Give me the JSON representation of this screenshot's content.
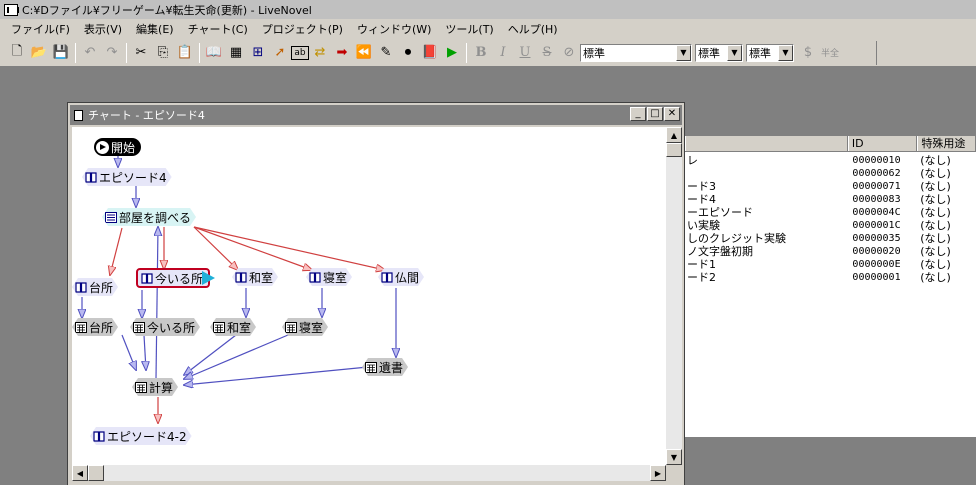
{
  "app": {
    "title": "C:¥Dファイル¥フリーゲーム¥転生天命(更新) - LiveNovel"
  },
  "menu": [
    "ファイル(F)",
    "表示(V)",
    "編集(E)",
    "チャート(C)",
    "プロジェクト(P)",
    "ウィンドウ(W)",
    "ツール(T)",
    "ヘルプ(H)"
  ],
  "toolbar": {
    "icons": [
      "new-icon",
      "open-icon",
      "save-icon",
      "undo-icon",
      "redo-icon",
      "cut-icon",
      "copy-icon",
      "paste-icon",
      "episode-icon",
      "calc-icon",
      "select-icon",
      "cursor-icon",
      "text-icon",
      "jump-icon",
      "arrow-right-icon",
      "rewind-icon",
      "tools-icon",
      "stop-icon",
      "book-icon",
      "run-icon",
      "bold-icon",
      "italic-icon",
      "underline-icon",
      "strike-icon",
      "disable-icon"
    ],
    "bold": "B",
    "italic": "I",
    "underline": "U",
    "strike": "S",
    "font_combo": "標準",
    "size_combo": "標準",
    "style_combo": "標準",
    "wide_label": "半全"
  },
  "list_window": {
    "columns": [
      "",
      "ID",
      "特殊用途"
    ],
    "rows": [
      {
        "name": "レ",
        "id": "00000010",
        "use": "(なし)"
      },
      {
        "name": "",
        "id": "00000062",
        "use": "(なし)"
      },
      {
        "name": "ード3",
        "id": "00000071",
        "use": "(なし)"
      },
      {
        "name": "ード4",
        "id": "00000083",
        "use": "(なし)"
      },
      {
        "name": "ーエピソード",
        "id": "0000004C",
        "use": "(なし)"
      },
      {
        "name": "い実験",
        "id": "0000001C",
        "use": "(なし)"
      },
      {
        "name": "しのクレジット実験",
        "id": "00000035",
        "use": "(なし)"
      },
      {
        "name": "ノ文字盤初期",
        "id": "00000020",
        "use": "(なし)"
      },
      {
        "name": "ード1",
        "id": "0000000E",
        "use": "(なし)"
      },
      {
        "name": "ード2",
        "id": "00000001",
        "use": "(なし)"
      }
    ]
  },
  "chart_window": {
    "title": "チャート - エピソード4",
    "nodes": {
      "start": "開始",
      "episode4": "エピソード4",
      "investigate": "部屋を調べる",
      "kitchen_ep": "台所",
      "current_ep": "今いる所",
      "washitsu_ep": "和室",
      "bedroom_ep": "寝室",
      "butsuma_ep": "仏間",
      "kitchen_calc": "台所",
      "current_calc": "今いる所",
      "washitsu_calc": "和室",
      "bedroom_calc": "寝室",
      "isho_calc": "遺書",
      "keisan_calc": "計算",
      "episode4_2": "エピソード4-2"
    }
  }
}
